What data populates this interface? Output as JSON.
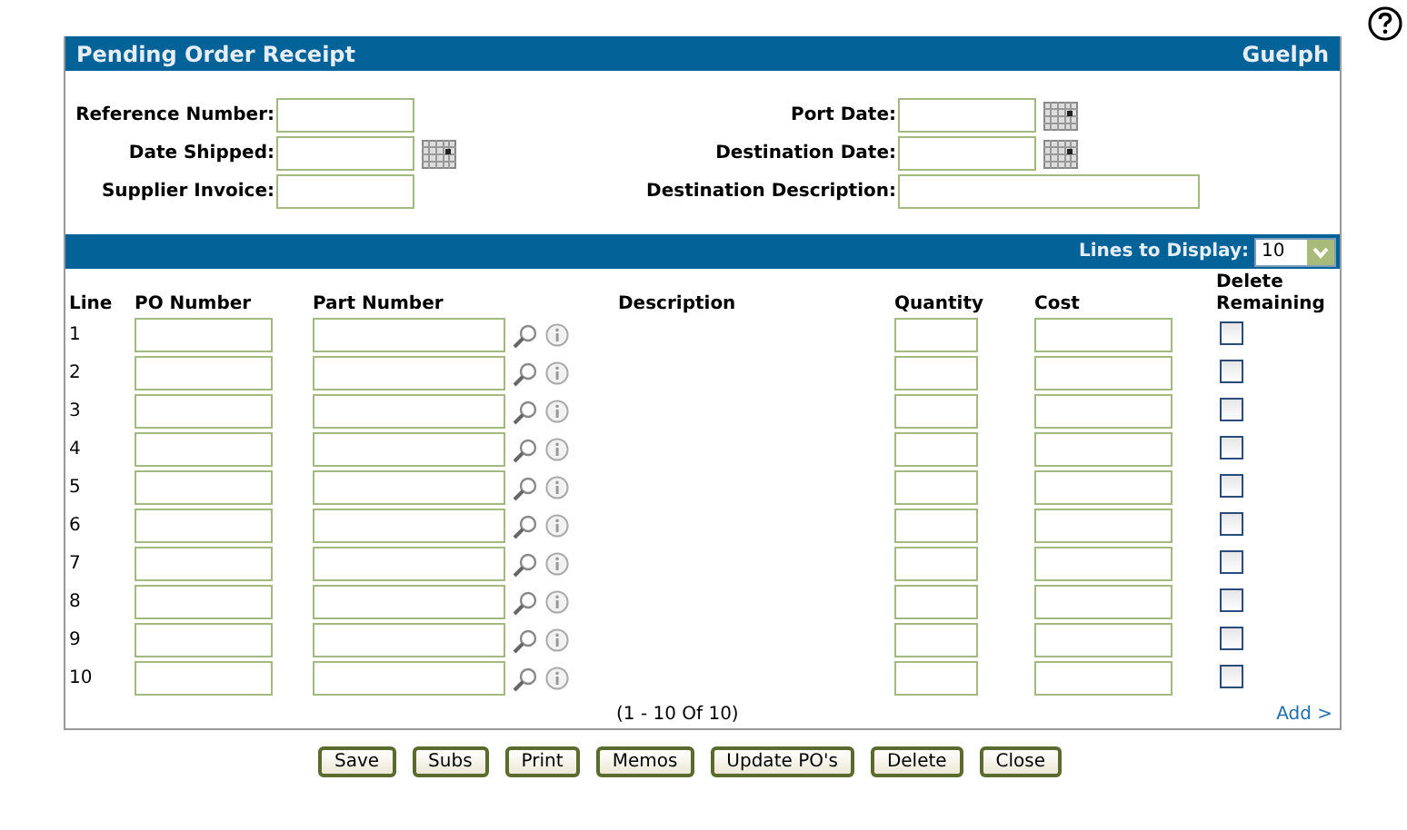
{
  "panel": {
    "title": "Pending Order Receipt",
    "location": "Guelph"
  },
  "form_left": [
    {
      "label": "Reference Number:",
      "calendar": false
    },
    {
      "label": "Date Shipped:",
      "calendar": true
    },
    {
      "label": "Supplier Invoice:",
      "calendar": false
    }
  ],
  "form_right": [
    {
      "label": "Port Date:",
      "calendar": true,
      "wide": false
    },
    {
      "label": "Destination Date:",
      "calendar": true,
      "wide": false
    },
    {
      "label": "Destination Description:",
      "calendar": false,
      "wide": true
    }
  ],
  "lines_to_display": {
    "label": "Lines to Display:",
    "value": "10"
  },
  "table": {
    "columns": [
      "Line",
      "PO Number",
      "Part Number",
      "Description",
      "Quantity",
      "Cost",
      "Delete Remaining"
    ],
    "rows": [
      {
        "line": "1",
        "delete_remaining": false
      },
      {
        "line": "2",
        "delete_remaining": false
      },
      {
        "line": "3",
        "delete_remaining": false
      },
      {
        "line": "4",
        "delete_remaining": false
      },
      {
        "line": "5",
        "delete_remaining": false
      },
      {
        "line": "6",
        "delete_remaining": false
      },
      {
        "line": "7",
        "delete_remaining": false
      },
      {
        "line": "8",
        "delete_remaining": false
      },
      {
        "line": "9",
        "delete_remaining": false
      },
      {
        "line": "10",
        "delete_remaining": false
      }
    ]
  },
  "pagination": "(1  -  10  Of  10)",
  "add_link": "Add >",
  "buttons": [
    "Save",
    "Subs",
    "Print",
    "Memos",
    "Update PO's",
    "Delete",
    "Close"
  ]
}
